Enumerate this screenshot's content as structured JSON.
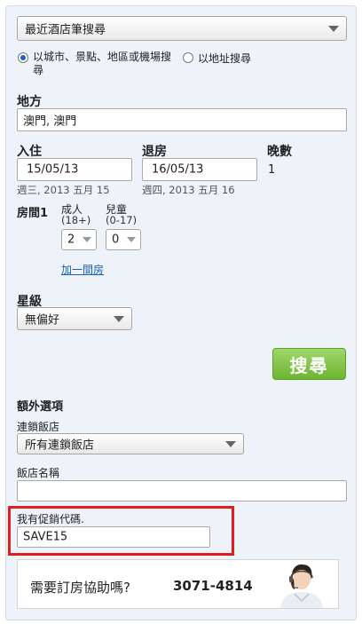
{
  "search_type": {
    "selected": "最近酒店筆搜尋"
  },
  "mode": {
    "option_city": "以城市、景點、地區或機場搜尋",
    "option_address": "以地址搜尋"
  },
  "destination": {
    "label": "地方",
    "value": "澳門, 澳門"
  },
  "checkin": {
    "label": "入住",
    "value": "15/05/13",
    "weekday": "週三, 2013 五月 15"
  },
  "checkout": {
    "label": "退房",
    "value": "16/05/13",
    "weekday": "週四, 2013 五月 16"
  },
  "nights": {
    "label": "晚數",
    "value": "1"
  },
  "room": {
    "label": "房間1",
    "adults_label": "成人",
    "adults_sub": "(18+)",
    "adults_value": "2",
    "children_label": "兒童",
    "children_sub": "(0-17)",
    "children_value": "0",
    "add_room": "加一間房"
  },
  "star": {
    "label": "星級",
    "value": "無偏好"
  },
  "search_button": "搜尋",
  "extra": {
    "title": "額外選項",
    "chain_label": "連鎖飯店",
    "chain_value": "所有連鎖飯店",
    "hotel_name_label": "飯店名稱",
    "hotel_name_value": "",
    "promo_label": "我有促銷代碼.",
    "promo_value": "SAVE15"
  },
  "help": {
    "text": "需要訂房協助嗎?",
    "phone": "3071-4814"
  },
  "colors": {
    "accent_green": "#6db532",
    "highlight_red": "#e01e1e",
    "link_blue": "#1a5fb4"
  }
}
